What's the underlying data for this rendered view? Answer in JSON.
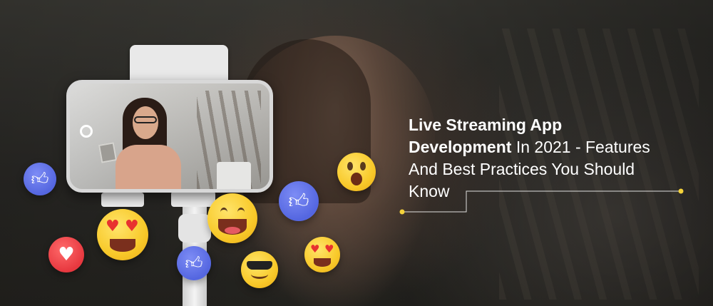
{
  "title": {
    "line1_bold": "Live Streaming App",
    "line2_bold": "Development",
    "line2_rest": " In 2021 - Features",
    "line3": "And Best Practices You Should",
    "line4": "Know"
  },
  "colors": {
    "accent_line": "#f4d23a",
    "reaction_like": "#5466e0",
    "reaction_heart": "#e7383f",
    "reaction_emoji": "#f8c92a"
  },
  "icons": [
    "like-icon",
    "heart-icon",
    "heart-eyes-emoji-icon",
    "grin-emoji-icon",
    "surprised-emoji-icon",
    "sunglasses-emoji-icon",
    "record-icon"
  ]
}
